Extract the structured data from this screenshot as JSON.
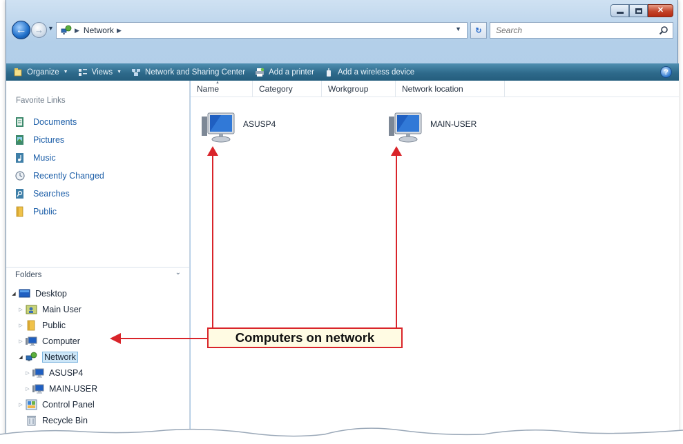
{
  "address_bar": {
    "crumbs": [
      "Network"
    ],
    "refresh_glyph": "↻",
    "search_placeholder": "Search"
  },
  "command_bar": {
    "items": [
      {
        "label": "Organize",
        "icon": "organize-icon",
        "has_menu": true
      },
      {
        "label": "Views",
        "icon": "views-icon",
        "has_menu": true
      },
      {
        "label": "Network and Sharing Center",
        "icon": "network-sharing-icon",
        "has_menu": false
      },
      {
        "label": "Add a printer",
        "icon": "printer-icon",
        "has_menu": false
      },
      {
        "label": "Add a wireless device",
        "icon": "wireless-device-icon",
        "has_menu": false
      }
    ],
    "help_glyph": "?"
  },
  "favorites": {
    "title": "Favorite Links",
    "items": [
      {
        "label": "Documents",
        "icon": "documents-icon"
      },
      {
        "label": "Pictures",
        "icon": "pictures-icon"
      },
      {
        "label": "Music",
        "icon": "music-icon"
      },
      {
        "label": "Recently Changed",
        "icon": "recently-changed-icon"
      },
      {
        "label": "Searches",
        "icon": "searches-icon"
      },
      {
        "label": "Public",
        "icon": "public-folder-icon"
      }
    ]
  },
  "folders": {
    "title": "Folders",
    "tree": [
      {
        "label": "Desktop",
        "icon": "desktop-icon",
        "level": 0,
        "expanded": true,
        "has_children": true,
        "selected": false
      },
      {
        "label": "Main User",
        "icon": "user-folder-icon",
        "level": 1,
        "expanded": false,
        "has_children": true,
        "selected": false
      },
      {
        "label": "Public",
        "icon": "public-folder-icon",
        "level": 1,
        "expanded": false,
        "has_children": true,
        "selected": false
      },
      {
        "label": "Computer",
        "icon": "computer-icon",
        "level": 1,
        "expanded": false,
        "has_children": true,
        "selected": false
      },
      {
        "label": "Network",
        "icon": "network-icon",
        "level": 1,
        "expanded": true,
        "has_children": true,
        "selected": true
      },
      {
        "label": "ASUSP4",
        "icon": "computer-icon",
        "level": 2,
        "expanded": false,
        "has_children": true,
        "selected": false
      },
      {
        "label": "MAIN-USER",
        "icon": "computer-icon",
        "level": 2,
        "expanded": false,
        "has_children": true,
        "selected": false
      },
      {
        "label": "Control Panel",
        "icon": "control-panel-icon",
        "level": 1,
        "expanded": false,
        "has_children": true,
        "selected": false
      },
      {
        "label": "Recycle Bin",
        "icon": "recycle-bin-icon",
        "level": 1,
        "expanded": false,
        "has_children": false,
        "selected": false
      }
    ]
  },
  "columns": [
    "Name",
    "Category",
    "Workgroup",
    "Network location"
  ],
  "network_items": [
    {
      "label": "ASUSP4",
      "icon": "computer-icon"
    },
    {
      "label": "MAIN-USER",
      "icon": "computer-icon"
    }
  ],
  "callout": {
    "text": "Computers on network",
    "color": "#d9242a"
  },
  "colors": {
    "command_bar": "#2e6a8b",
    "link_text": "#1c5ea8",
    "selection": "#cde6f7"
  }
}
